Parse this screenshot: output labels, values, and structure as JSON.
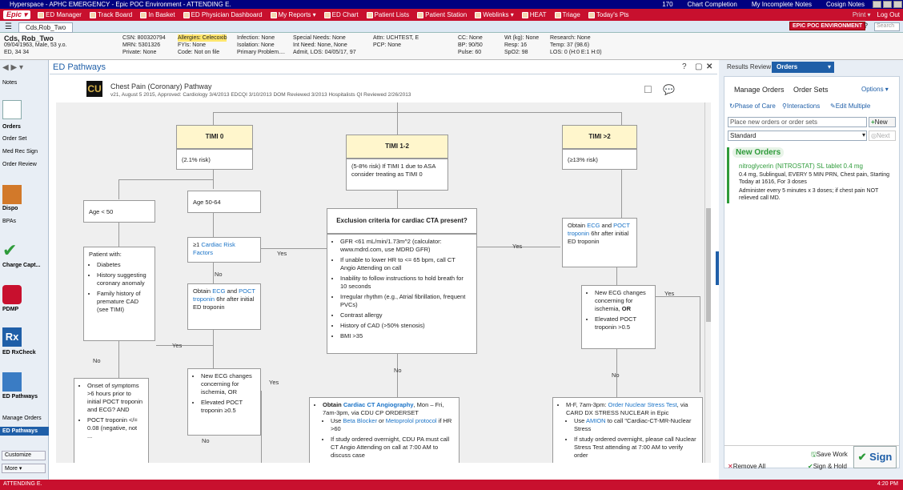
{
  "titlebar": {
    "app": "Hyperspace - APHC EMERGENCY - Epic POC Environment - ATTENDING E.",
    "msg_count": "170",
    "chart_completion": "Chart Completion",
    "incomplete_notes": "My Incomplete Notes",
    "cosign_notes": "Cosign Notes"
  },
  "menubar": {
    "epic": "Epic ▾",
    "items": [
      "ED Manager",
      "Track Board",
      "In Basket",
      "ED Physician Dashboard",
      "My Reports ▾",
      "ED Chart",
      "Patient Lists",
      "Patient Station",
      "Weblinks ▾",
      "HEAT",
      "Triage",
      "Today's Pts"
    ],
    "print": "Print ▾",
    "logout": "Log Out"
  },
  "tabbar": {
    "patient_tab": "Cds,Rob_Two",
    "env": "EPIC POC ENVIRONMENT",
    "search_placeholder": "Search"
  },
  "patient": {
    "name": "Cds, Rob_Two",
    "dob": "09/04/1963, Male, 53 y.o.",
    "loc": "ED, 34 34",
    "c1": [
      "CSN: 800320794",
      "MRN: 5301326",
      "Private: None"
    ],
    "c2": [
      "Allergies: Celecoxib",
      "FYIs: None",
      "Code: Not on file"
    ],
    "c3": [
      "Infection: None",
      "Isolation: None",
      "Primary Problem...."
    ],
    "c4": [
      "Special Needs: None",
      "Int Need: None, None",
      "Admit, LOS: 04/05/17, 97"
    ],
    "c5": [
      "Attn: UCHTEST, E",
      "PCP: None"
    ],
    "c6": [
      "CC: None",
      "BP: 90/50",
      "Pulse: 60"
    ],
    "c7": [
      "Wt (kg): None",
      "Resp: 16",
      "SpO2: 98"
    ],
    "c8": [
      "Research: None",
      "Temp: 37 (98.6)",
      "LOS: 0 (H:0 E:1 H:0)"
    ]
  },
  "leftnav": {
    "notes": "Notes",
    "orders": "Orders",
    "order_set": "Order Set",
    "med_rec": "Med Rec Sign",
    "order_review": "Order Review",
    "dispo": "Dispo",
    "bpas": "BPAs",
    "charge": "Charge Capt...",
    "pdmp": "PDMP",
    "rxcheck": "ED RxCheck",
    "ed_pathways": "ED Pathways",
    "manage_orders": "Manage Orders",
    "ed_pathways_active": "ED Pathways",
    "customize": "Customize",
    "more": "More ▾"
  },
  "pathway": {
    "panel_title": "ED Pathways",
    "name": "Chest Pain (Coronary) Pathway",
    "meta": "v21, August 5 2015, Approved: Cardiology 3/4/2013 EDCQI 3/10/2013 DOM Reviewed 3/2013 Hospitalists QI Reviewed 2/26/2013",
    "logo": "CU"
  },
  "flow": {
    "timi0": "TIMI 0",
    "timi0_risk": "(2.1% risk)",
    "timi12": "TIMI 1-2",
    "timi12_risk": "(5-8% risk) If TIMI 1 due to ASA consider treating as TIMI 0",
    "timi2": "TIMI >2",
    "timi2_risk": "(≥13% risk)",
    "age_lt50": "Age < 50",
    "age_5064": "Age 50-64",
    "crf_a": "≥1 ",
    "crf_link": "Cardiac Risk Factors",
    "ecg0_a": "Obtain ",
    "ecg0_link1": "ECG",
    "ecg0_b": " and ",
    "ecg0_link2": "POCT troponin",
    "ecg0_c": " 6hr after initial ED troponin",
    "patient_with": "Patient with:",
    "pw": [
      "Diabetes",
      "History suggesting coronary anomaly",
      "Family history of premature CAD (see TIMI)"
    ],
    "onset": [
      "Onset of symptoms >6 hours prior to initial POCT troponin and ECG? AND",
      "POCT troponin </= 0.08 (negative, not ..."
    ],
    "newecg": [
      "New ECG changes concerning for ischemia, OR",
      "Elevated POCT troponin ≥0.5"
    ],
    "excl_title": "Exclusion criteria for cardiac CTA present?",
    "excl": [
      "GFR <61 mL/min/1.73m^2 (calculator: www.mdrd.com, use MDRD GFR)",
      "If unable to lower HR to <= 65 bpm, call CT Angio Attending on call",
      "Inability to follow instructions to hold breath for 10 seconds",
      "Irregular rhythm (e.g., Atrial fibrillation, frequent PVCs)",
      "Contrast allergy",
      "History of CAD (>50% stenosis)",
      "BMI >35"
    ],
    "cta_a": "Obtain ",
    "cta_link": "Cardiac CT Angiography",
    "cta_b": ", Mon – Fri, 7am-3pm, via CDU CP ORDERSET",
    "cta_li1a": "Use ",
    "cta_li1b": "Beta Blocker",
    "cta_li1c": " or ",
    "cta_li1d": "Metoprolol protocol",
    "cta_li1e": " if HR >60",
    "cta_li2": "If study ordered overnight, CDU PA must call CT Angio Attending on call at 7:00 AM to discuss case",
    "ecg2_a": "Obtain ",
    "ecg2_link1": "ECG",
    "ecg2_b": " and ",
    "ecg2_link2": "POCT troponin",
    "ecg2_c": " 6hr after initial ED troponin",
    "newecg2_a": "New ECG changes concerning for ischemia, ",
    "newecg2_or": "OR",
    "newecg2_b": "Elevated POCT troponin >0.5",
    "nuc_a": "M-F, 7am-3pm: ",
    "nuc_link": "Order Nuclear Stress Test",
    "nuc_b": ", via CARD DX STRESS NUCLEAR in Epic",
    "nuc_li1a": "Use ",
    "nuc_li1b": "AMION",
    "nuc_li1c": " to call \"Cardiac-CT-MR-Nuclear Stress",
    "nuc_li2": "If study ordered overnight, please call Nuclear Stress Test attending at 7:00 AM to verify order",
    "yes": "Yes",
    "no": "No"
  },
  "orders": {
    "tab_review": "Results Review",
    "tab_orders": "Orders",
    "manage": "Manage Orders",
    "sets": "Order Sets",
    "options": "Options ▾",
    "phase": "Phase of Care",
    "interactions": "Interactions",
    "edit": "Edit Multiple",
    "placeholder": "Place new orders or order sets",
    "new": "New",
    "mode": "Standard",
    "next": "Next",
    "new_orders": "New Orders",
    "med_name": "nitroglycerin (NITROSTAT) SL tablet 0.4 mg",
    "med_detail1": "0.4 mg, Sublingual, EVERY 5 MIN PRN, Chest pain, Starting Today at 1616, For 3 doses",
    "med_detail2": "Administer every 5 minutes x 3 doses; if chest pain NOT relieved call MD.",
    "save_work": "Save Work",
    "remove_all": "Remove All",
    "sign_hold": "Sign & Hold",
    "sign": "Sign"
  },
  "status": {
    "user": "ATTENDING E.",
    "time": "4:20 PM"
  }
}
